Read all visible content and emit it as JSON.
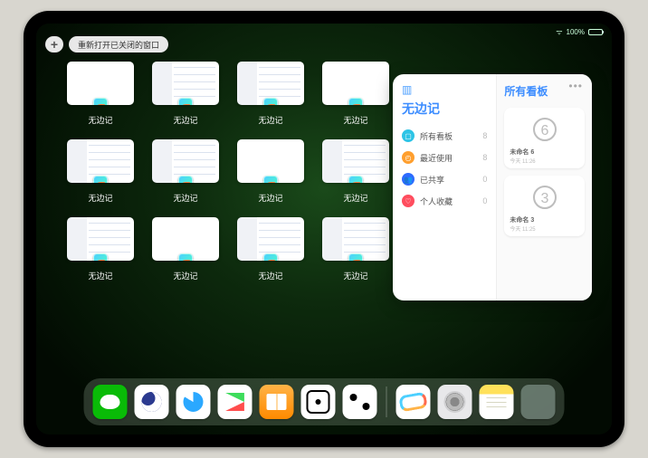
{
  "statusbar": {
    "battery_pct": "100%"
  },
  "top": {
    "plus_label": "+",
    "pill_label": "重新打开已关闭的窗口"
  },
  "windows": [
    {
      "label": "无边记",
      "style": "blank"
    },
    {
      "label": "无边记",
      "style": "detailed"
    },
    {
      "label": "无边记",
      "style": "detailed"
    },
    {
      "label": "无边记",
      "style": "blank"
    },
    {
      "label": "无边记",
      "style": "detailed"
    },
    {
      "label": "无边记",
      "style": "detailed"
    },
    {
      "label": "无边记",
      "style": "blank"
    },
    {
      "label": "无边记",
      "style": "detailed"
    },
    {
      "label": "无边记",
      "style": "detailed"
    },
    {
      "label": "无边记",
      "style": "blank"
    },
    {
      "label": "无边记",
      "style": "detailed"
    },
    {
      "label": "无边记",
      "style": "detailed"
    }
  ],
  "popover": {
    "title": "无边记",
    "right_title": "所有看板",
    "items": [
      {
        "icon": "square",
        "color": "#2ec4e6",
        "label": "所有看板",
        "count": "8"
      },
      {
        "icon": "clock",
        "color": "#ff9f2e",
        "label": "最近使用",
        "count": "8"
      },
      {
        "icon": "people",
        "color": "#2e6bff",
        "label": "已共享",
        "count": "0"
      },
      {
        "icon": "heart",
        "color": "#ff4d5e",
        "label": "个人收藏",
        "count": "0"
      }
    ],
    "boards": [
      {
        "name": "未命名 6",
        "date": "今天 11:26",
        "digit": "6"
      },
      {
        "name": "未命名 3",
        "date": "今天 11:25",
        "digit": "3"
      }
    ]
  },
  "dock": {
    "apps": [
      {
        "name": "wechat"
      },
      {
        "name": "app2"
      },
      {
        "name": "app3"
      },
      {
        "name": "play"
      },
      {
        "name": "books"
      },
      {
        "name": "dice"
      },
      {
        "name": "x"
      }
    ],
    "recent": [
      {
        "name": "freeform"
      },
      {
        "name": "settings"
      },
      {
        "name": "notes"
      },
      {
        "name": "folder"
      }
    ]
  }
}
